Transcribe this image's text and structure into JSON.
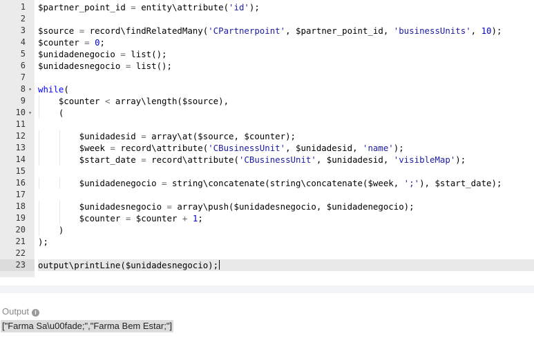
{
  "editor": {
    "lines": [
      {
        "num": "1",
        "text": "$partner_point_id = entity\\attribute('id');"
      },
      {
        "num": "2",
        "text": ""
      },
      {
        "num": "3",
        "text": "$source = record\\findRelatedMany('CPartnerpoint', $partner_point_id, 'businessUnits', 10);"
      },
      {
        "num": "4",
        "text": "$counter = 0;"
      },
      {
        "num": "5",
        "text": "$unidadenegocio = list();"
      },
      {
        "num": "6",
        "text": "$unidadesnegocio = list();"
      },
      {
        "num": "7",
        "text": ""
      },
      {
        "num": "8",
        "text": "while("
      },
      {
        "num": "9",
        "text": "    $counter < array\\length($source),"
      },
      {
        "num": "10",
        "text": "    ("
      },
      {
        "num": "11",
        "text": ""
      },
      {
        "num": "12",
        "text": "        $unidadesid = array\\at($source, $counter);"
      },
      {
        "num": "13",
        "text": "        $week = record\\attribute('CBusinessUnit', $unidadesid, 'name');"
      },
      {
        "num": "14",
        "text": "        $start_date = record\\attribute('CBusinessUnit', $unidadesid, 'visibleMap');"
      },
      {
        "num": "15",
        "text": ""
      },
      {
        "num": "16",
        "text": "        $unidadenegocio = string\\concatenate(string\\concatenate($week, ';'), $start_date);"
      },
      {
        "num": "17",
        "text": ""
      },
      {
        "num": "18",
        "text": "        $unidadesnegocio = array\\push($unidadesnegocio, $unidadenegocio);"
      },
      {
        "num": "19",
        "text": "        $counter = $counter + 1;"
      },
      {
        "num": "20",
        "text": "    )"
      },
      {
        "num": "21",
        "text": ");"
      },
      {
        "num": "22",
        "text": ""
      },
      {
        "num": "23",
        "text": "output\\printLine($unidadesnegocio);"
      }
    ],
    "fold_lines": [
      "8",
      "10"
    ],
    "active_line": "23",
    "fold_icon": "caret-down-icon"
  },
  "output": {
    "label": "Output",
    "info_icon": "info-icon",
    "value": "[\"Farma Sa\\u00fade;\",\"Farma Bem Estar;\"]"
  },
  "colors": {
    "string": "#1a1aa6",
    "number": "#0000cd",
    "keyword": "#0000ff",
    "gutter": "#ebebeb"
  }
}
